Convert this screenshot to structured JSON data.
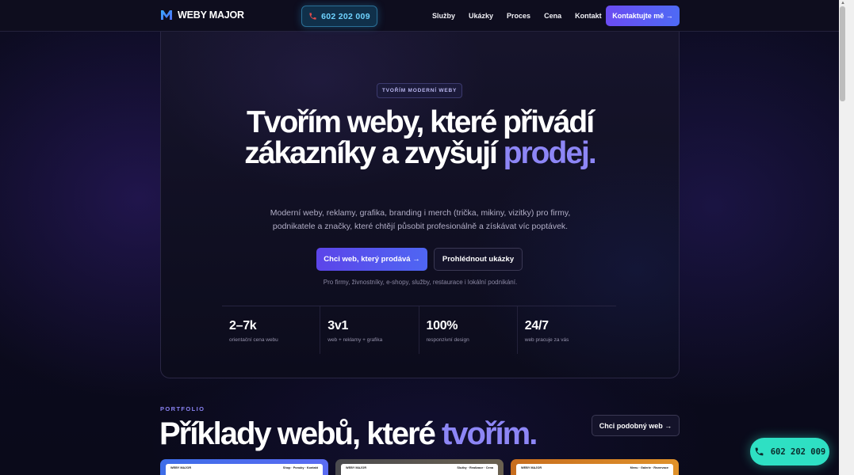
{
  "header": {
    "brand": "WEBY MAJOR",
    "phone": "602 202 009",
    "nav": [
      "Služby",
      "Ukázky",
      "Proces",
      "Cena",
      "Kontakt"
    ],
    "cta": "Kontaktujte mě →"
  },
  "hero": {
    "badge": "TVOŘÍM MODERNÍ WEBY",
    "headline_part1": "Tvořím weby, které přivádí zákazníky a zvyšují ",
    "headline_accent": "prodej.",
    "lead": "Moderní weby, reklamy, grafika, branding i merch (trička, mikiny, vizitky) pro firmy, podnikatele a značky, které chtějí působit profesionálně a získávat víc poptávek.",
    "primary_button": "Chci web, který prodává →",
    "secondary_button": "Prohlédnout ukázky",
    "note": "Pro firmy, živnostníky, e-shopy, služby, restaurace i lokální podnikání.",
    "stats": [
      {
        "value": "2–7k",
        "label": "orientační cena webu"
      },
      {
        "value": "3v1",
        "label": "web + reklamy + grafika"
      },
      {
        "value": "100%",
        "label": "responzivní design"
      },
      {
        "value": "24/7",
        "label": "web pracuje za vás"
      }
    ]
  },
  "portfolio": {
    "eyebrow": "PORTFOLIO",
    "title_part1": "Příklady webů, které ",
    "title_accent": "tvořím.",
    "button": "Chci podobný web →",
    "cards": [
      {
        "brand": "WEBY MAJOR",
        "tags": "Shop · Ponuky · Kontakt"
      },
      {
        "brand": "WEBY MAJOR",
        "tags": "Služby · Realizace · Cena"
      },
      {
        "brand": "WEBY MAJOR",
        "tags": "Menu · Galerie · Rezervace"
      }
    ]
  },
  "floating_phone": "602 202 009",
  "colors": {
    "accent": "#8d86f6",
    "primary_button": "#5c45e9",
    "phone_pill": "#6fd3ff",
    "floating_phone_bg": "#2ee0c3"
  },
  "icons": {
    "logo": "logo-m-icon",
    "phone": "phone-icon"
  }
}
